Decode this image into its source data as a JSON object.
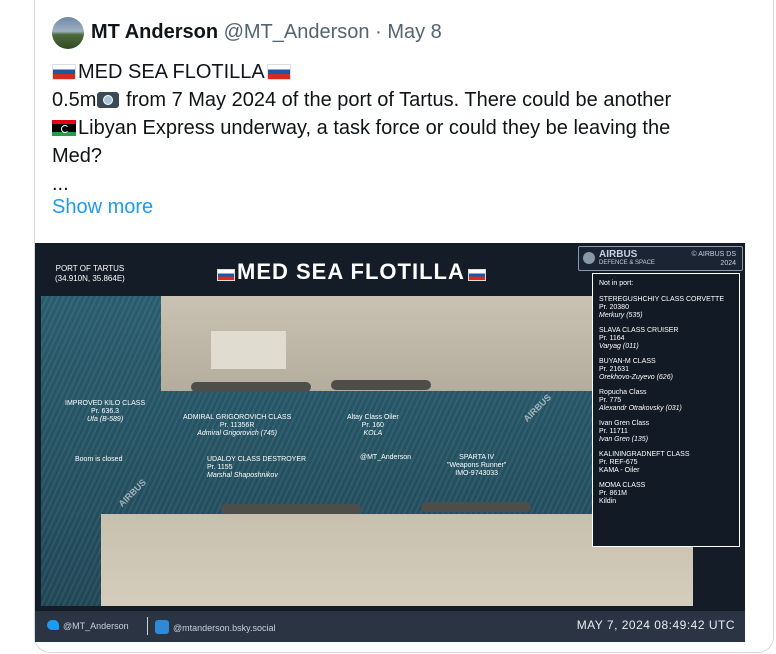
{
  "tweet": {
    "display_name": "MT Anderson",
    "handle": "@MT_Anderson",
    "separator": "·",
    "date": "May 8",
    "text_line1": "MED SEA FLOTILLA",
    "text_line2_pre": "0.5m",
    "text_line2_post": " from 7 May 2024 of the port of Tartus. There could be another",
    "text_line3": "Libyan Express underway, a task force or could they be leaving the",
    "text_line4": "Med?",
    "text_line5": "...",
    "show_more": "Show more"
  },
  "media": {
    "title": "MED SEA FLOTILLA",
    "port_label": "PORT OF TARTUS",
    "port_coords": "(34.910N, 35.864E)",
    "airbus_name": "AIRBUS",
    "airbus_sub": "DEFENCE & SPACE",
    "airbus_copy_line1": "© AIRBUS DS",
    "airbus_copy_line2": "2024",
    "watermark": "AIRBUS",
    "legend": {
      "heading": "Not in port:",
      "entries": [
        {
          "cls": "STEREGUSHCHIY CLASS CORVETTE",
          "pr": "Pr. 20380",
          "name": "Merkury (535)"
        },
        {
          "cls": "SLAVA CLASS CRUISER",
          "pr": "Pr. 1164",
          "name": "Varyag (011)"
        },
        {
          "cls": "BUYAN-M CLASS",
          "pr": "Pr. 21631",
          "name": "Orekhovo-Zuyevo (626)"
        },
        {
          "cls": "Ropucha Class",
          "pr": "Pr. 775",
          "name": "Alexandr Otrakovsky (031)"
        },
        {
          "cls": "Ivan Gren Class",
          "pr": "Pr. 11711",
          "name": "Ivan Gren (135)"
        },
        {
          "cls": "KALININGRADNEFT CLASS",
          "pr": "Pr. REF-675",
          "name": "KAMA - Oiler"
        },
        {
          "cls": "MOMA CLASS",
          "pr": "Pr. 861M",
          "name": "Kildin"
        }
      ]
    },
    "annotations": {
      "kilo": {
        "cls": "IMPROVED KILO CLASS",
        "pr": "Pr. 636.3",
        "name": "Ufa (B-589)"
      },
      "grigorovich": {
        "cls": "ADMIRAL GRIGOROVICH CLASS",
        "pr": "Pr. 11356R",
        "name": "Admiral Grigorovich (745)"
      },
      "altay": {
        "cls": "Altay Class Oiler",
        "pr": "Pr. 160",
        "name": "KOLA"
      },
      "boom": "Boom is closed",
      "udaloy": {
        "cls": "UDALOY CLASS DESTROYER",
        "pr": "Pr. 1155",
        "name": "Marshal Shaposhnikov"
      },
      "credit": "@MT_Anderson",
      "sparta": {
        "cls": "SPARTA IV",
        "pr": "\"Weapons Runner\"",
        "name": "IMO-9743033"
      }
    },
    "footer": {
      "handle": "@MT_Anderson",
      "bsky": "@mtanderson.bsky.social",
      "timestamp": "MAY 7, 2024 08:49:42 UTC"
    }
  },
  "colors": {
    "link": "#1d9bf0",
    "text": "#0f1419",
    "muted": "#536471",
    "media_bg": "#141c27"
  }
}
